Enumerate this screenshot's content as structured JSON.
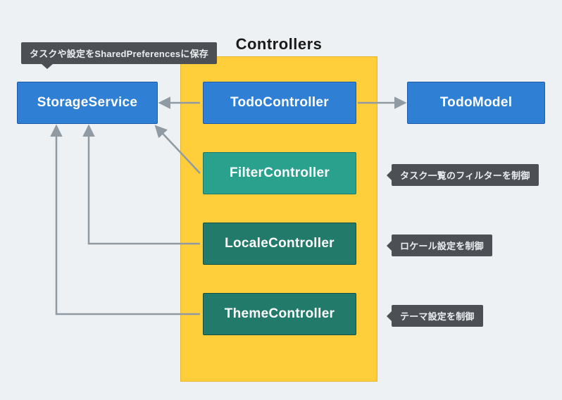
{
  "title": "Controllers",
  "nodes": {
    "storage": {
      "label": "StorageService"
    },
    "todo": {
      "label": "TodoController"
    },
    "model": {
      "label": "TodoModel"
    },
    "filter": {
      "label": "FilterController"
    },
    "locale": {
      "label": "LocaleController"
    },
    "theme": {
      "label": "ThemeController"
    }
  },
  "tooltips": {
    "storage": "タスクや設定をSharedPreferencesに保存",
    "filter": "タスク一覧のフィルターを制御",
    "locale": "ロケール設定を制御",
    "theme": "テーマ設定を制御"
  },
  "colors": {
    "group_bg": "#ffce3a",
    "blue": "#2f80d5",
    "teal_light": "#29a18c",
    "teal_dark": "#227a6b",
    "tooltip": "#4c5055",
    "arrow": "#8f9aa3"
  },
  "chart_data": {
    "type": "diagram",
    "title": "Controllers",
    "group": {
      "name": "Controllers",
      "members": [
        "TodoController",
        "FilterController",
        "LocaleController",
        "ThemeController"
      ]
    },
    "nodes": [
      {
        "id": "StorageService",
        "note": "タスクや設定をSharedPreferencesに保存"
      },
      {
        "id": "TodoController"
      },
      {
        "id": "TodoModel"
      },
      {
        "id": "FilterController",
        "note": "タスク一覧のフィルターを制御"
      },
      {
        "id": "LocaleController",
        "note": "ロケール設定を制御"
      },
      {
        "id": "ThemeController",
        "note": "テーマ設定を制御"
      }
    ],
    "edges": [
      {
        "from": "TodoController",
        "to": "StorageService"
      },
      {
        "from": "TodoController",
        "to": "TodoModel"
      },
      {
        "from": "FilterController",
        "to": "StorageService"
      },
      {
        "from": "LocaleController",
        "to": "StorageService"
      },
      {
        "from": "ThemeController",
        "to": "StorageService"
      }
    ]
  }
}
